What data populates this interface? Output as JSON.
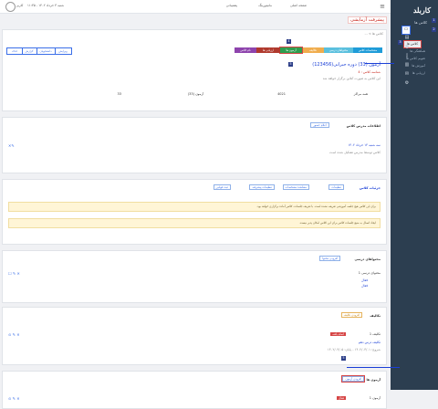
{
  "sidebar": {
    "logo": "کاربلد",
    "section_label": "کلاس ها",
    "active_item": "کلاس ها",
    "sub_items": [
      "کلاس ها",
      "هماهنگی ها",
      "تقویم کلاس ها",
      "آموزش ها",
      "ارزیابی ها"
    ],
    "badges": [
      "1",
      "2",
      "3",
      "4",
      "5"
    ]
  },
  "topbar": {
    "item1": "صفحه اصلی",
    "item2": "مانیتورینگ",
    "item3": "پشتیبانی",
    "date": "شنبه ۳ خرداد ۱۴۰۲ - ۱۱:۳۵",
    "username": "کاربر"
  },
  "page": {
    "title": "پیشرفت آزمایشی",
    "breadcrumb": "کلاس ها > ..."
  },
  "action_buttons": [
    {
      "label": "مشخصات کلاس",
      "color": "#1f9cd8"
    },
    {
      "label": "محتواهای درسی",
      "color": "#5bc0de"
    },
    {
      "label": "تکالیف",
      "color": "#f0ad4e"
    },
    {
      "label": "آزمون ها",
      "color": "#2e9e4f"
    },
    {
      "label": "ارزیابی ها",
      "color": "#b03a2e"
    },
    {
      "label": "نام کلاس",
      "color": "#8e44ad"
    }
  ],
  "left_buttons": [
    "ویرایش",
    "دانشجویان",
    "گزارش",
    "حذف"
  ],
  "class_header": {
    "name": "آزمون (33) دوره جبرانی(123456)",
    "code_label": "شناسه کلاس",
    "code_value": "4",
    "desc": "این کلاس به صورت آنلاین برگزار خواهد شد",
    "stats": [
      {
        "label": "نوع",
        "value": "همه مراکز"
      },
      {
        "label": "شناسه",
        "value": "4021"
      },
      {
        "label": "نام",
        "value": "آزمون (33)"
      },
      {
        "label": "ظرفیت",
        "value": "33"
      }
    ]
  },
  "sections": {
    "teacher": {
      "title": "اطلاعات مدرس کلاس",
      "add_label": "اعلام حضور",
      "item": "سه شنبه ۱۴ خرداد ۱۴۰۲",
      "note": "کلاس توسط مدرس تشکیل شده است"
    },
    "details": {
      "title": "جزئیات کلاس",
      "tabs": [
        "تنظیمات",
        "مشاهده مشخصات",
        "تنظیمات پیشرفته",
        "ثبت قوانین"
      ],
      "notice1": "برای این کلاس هیچ جلسه آموزشی تعریف نشده است. با تعریف جلسات، کلاس آماده برگزاری خواهد بود.",
      "notice2": "ایجاد اتصال به منبع جلسات کلاس برای این کلاس امکان پذیر نیست."
    },
    "content": {
      "title": "محتواهای درسی",
      "add_label": "افزودن محتوا",
      "item": "محتوای درسی 1",
      "meta1": "فعال",
      "meta2": "فعال"
    },
    "homework": {
      "title": "تکالیف",
      "add_label": "افزودن تکلیف",
      "item": "تکلیف 1",
      "status": "اتمام یافته",
      "subtitle": "تکلیف درس دهم",
      "dates": "شروع: ۱۴۰۲/۰۳/۰۱ - پایان: ۱۴۰۲/۰۳/۰۵"
    },
    "exams": {
      "title": "آزمون ها",
      "add_label": "افزودن آزمون",
      "item": "آزمون 1",
      "status": "فعال"
    }
  }
}
